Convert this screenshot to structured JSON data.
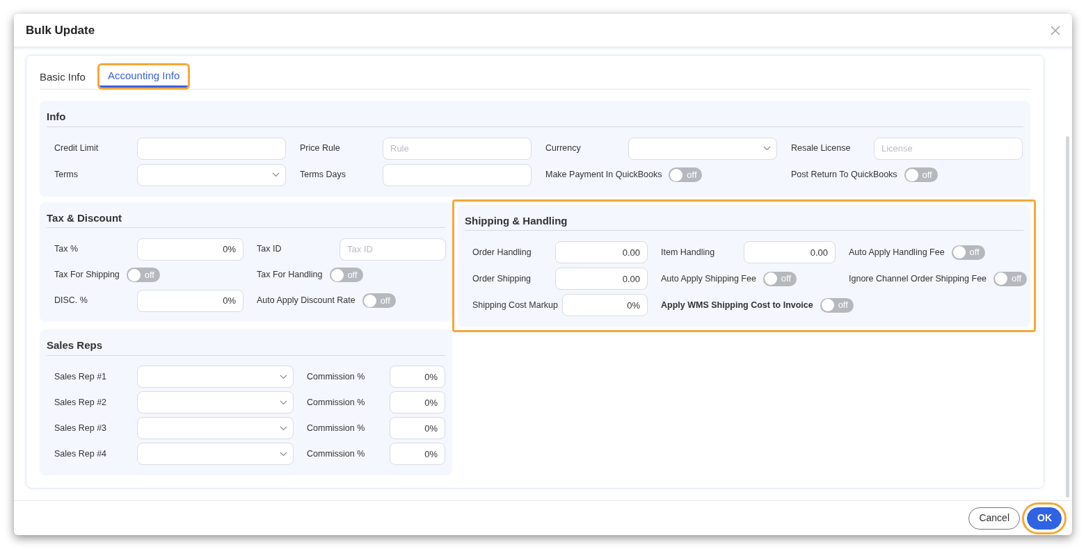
{
  "dialog": {
    "title": "Bulk Update"
  },
  "tabs": [
    {
      "label": "Basic Info",
      "selected": false,
      "highlighted": false
    },
    {
      "label": "Accounting Info",
      "selected": true,
      "highlighted": true
    }
  ],
  "top": [
    {
      "title": "Info",
      "highlighted": false,
      "rows": [
        [
          {
            "label": "Credit Limit",
            "kind": "input"
          },
          {
            "label": "Price Rule",
            "kind": "input",
            "placeholder": "Rule"
          },
          {
            "label": "Currency",
            "kind": "select"
          },
          {
            "label": "Resale License",
            "kind": "input",
            "placeholder": "License"
          }
        ],
        [
          {
            "label": "Terms",
            "kind": "select"
          },
          {
            "label": "Terms Days",
            "kind": "input"
          },
          {
            "label": "Make Payment In QuickBooks",
            "kind": "toggle",
            "on": false,
            "state_text": "off"
          },
          {
            "label": "Post Return To QuickBooks",
            "kind": "toggle",
            "on": false,
            "state_text": "off"
          }
        ]
      ]
    }
  ],
  "left_column": [
    {
      "title": "Tax & Discount",
      "highlighted": false,
      "rows": [
        [
          {
            "label": "Tax %",
            "kind": "input",
            "value": "0%"
          },
          {
            "label": "Tax ID",
            "kind": "input",
            "placeholder": "Tax ID"
          }
        ],
        [
          {
            "label": "Tax For Shipping",
            "kind": "toggle",
            "on": false,
            "state_text": "off"
          },
          {
            "label": "Tax For Handling",
            "kind": "toggle",
            "on": false,
            "state_text": "off"
          }
        ],
        [
          {
            "label": "DISC. %",
            "kind": "input",
            "value": "0%"
          },
          {
            "label": "Auto Apply Discount Rate",
            "kind": "toggle",
            "on": false,
            "state_text": "off"
          }
        ]
      ]
    },
    {
      "title": "Sales Reps",
      "highlighted": false,
      "rows": [
        [
          {
            "label": "Sales Rep #1",
            "kind": "select"
          },
          {
            "label": "Commission %",
            "kind": "input",
            "value": "0%"
          }
        ],
        [
          {
            "label": "Sales Rep #2",
            "kind": "select"
          },
          {
            "label": "Commission %",
            "kind": "input",
            "value": "0%"
          }
        ],
        [
          {
            "label": "Sales Rep #3",
            "kind": "select"
          },
          {
            "label": "Commission %",
            "kind": "input",
            "value": "0%"
          }
        ],
        [
          {
            "label": "Sales Rep #4",
            "kind": "select"
          },
          {
            "label": "Commission %",
            "kind": "input",
            "value": "0%"
          }
        ]
      ]
    }
  ],
  "right_column": [
    {
      "title": "Shipping & Handling",
      "highlighted": true,
      "rows": [
        [
          {
            "label": "Order Handling",
            "kind": "input",
            "value": "0.00"
          },
          {
            "label": "Item Handling",
            "kind": "input",
            "value": "0.00"
          },
          {
            "label": "Auto Apply Handling Fee",
            "kind": "toggle",
            "on": false,
            "state_text": "off"
          }
        ],
        [
          {
            "label": "Order Shipping",
            "kind": "input",
            "value": "0.00"
          },
          {
            "label": "Auto Apply Shipping Fee",
            "kind": "toggle",
            "on": false,
            "state_text": "off"
          },
          {
            "label": "Ignore Channel Order Shipping Fee",
            "kind": "toggle",
            "on": false,
            "state_text": "off"
          }
        ],
        [
          {
            "label": "Shipping Cost Markup",
            "kind": "input",
            "value": "0%"
          },
          {
            "label": "Apply WMS Shipping Cost to Invoice",
            "kind": "toggle",
            "on": false,
            "state_text": "off",
            "bold": true
          }
        ]
      ]
    }
  ],
  "buttons": [
    {
      "label": "Cancel",
      "kind": "secondary",
      "highlighted": false
    },
    {
      "label": "OK",
      "kind": "primary",
      "highlighted": true
    }
  ]
}
